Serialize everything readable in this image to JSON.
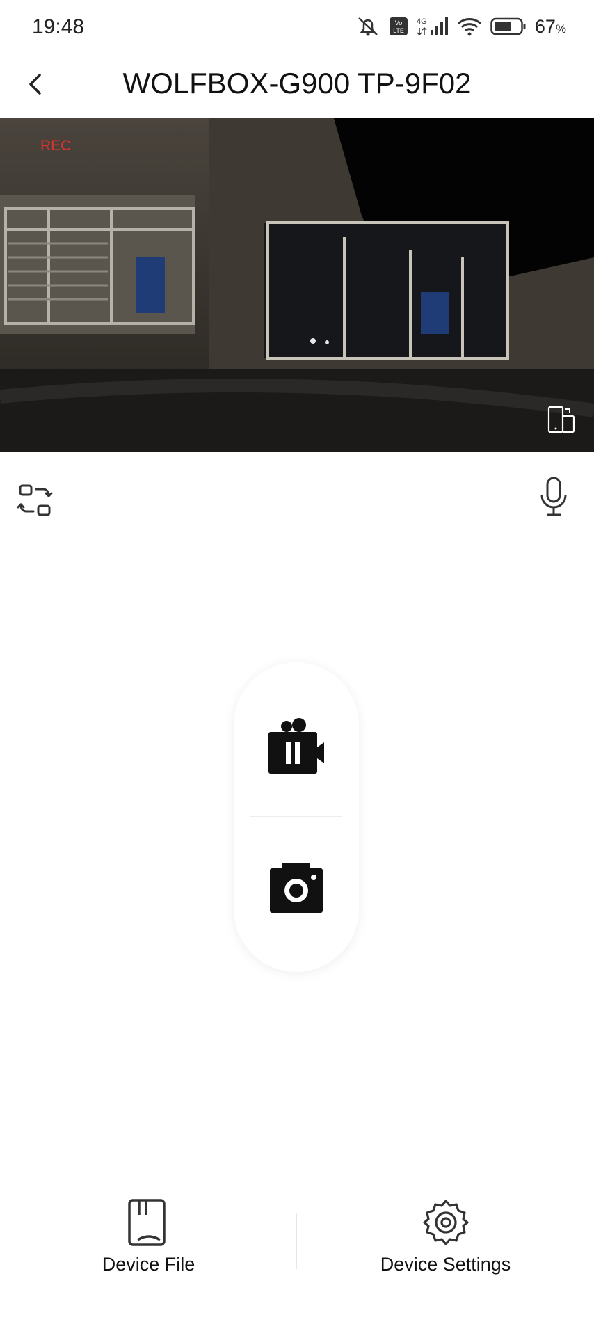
{
  "status_bar": {
    "time": "19:48",
    "network": "4G",
    "volte": "Vo LTE",
    "battery_percent": "67",
    "battery_unit": "%",
    "battery_level": 0.67,
    "icons": [
      "mute-icon",
      "volte-icon",
      "signal-icon",
      "wifi-icon",
      "battery-icon"
    ]
  },
  "header": {
    "title": "WOLFBOX-G900 TP-9F02",
    "back_icon": "back-chevron-icon"
  },
  "live_view": {
    "rec_label": "REC",
    "rec_color": "#e0332f",
    "landscape_icon": "landscape-toggle-icon"
  },
  "controls": {
    "switch_camera_icon": "switch-camera-icon",
    "microphone_icon": "microphone-icon",
    "record_icon": "video-pause-icon",
    "snapshot_icon": "camera-icon"
  },
  "bottom_nav": {
    "device_file": {
      "label": "Device File",
      "icon": "sd-card-icon"
    },
    "device_settings": {
      "label": "Device Settings",
      "icon": "gear-icon"
    }
  }
}
